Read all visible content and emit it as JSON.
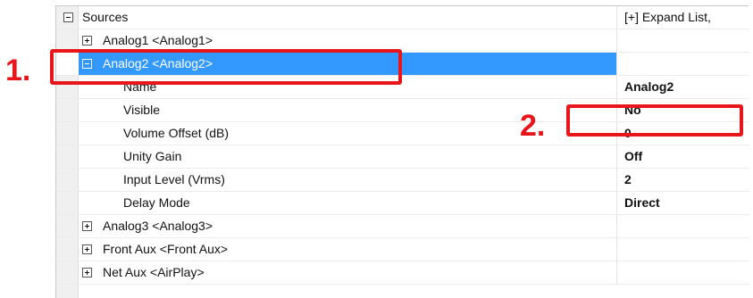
{
  "header": {
    "sources_label": "Sources",
    "expand_list_label": "[+] Expand List,"
  },
  "tree": [
    {
      "label": "Analog1 <Analog1>",
      "state": "collapsed"
    },
    {
      "label": "Analog2 <Analog2>",
      "state": "expanded",
      "selected": true,
      "properties": [
        {
          "name": "Name",
          "value": "Analog2"
        },
        {
          "name": "Visible",
          "value": "No"
        },
        {
          "name": "Volume Offset (dB)",
          "value": "0"
        },
        {
          "name": "Unity Gain",
          "value": "Off"
        },
        {
          "name": "Input Level (Vrms)",
          "value": "2"
        },
        {
          "name": "Delay Mode",
          "value": "Direct"
        }
      ]
    },
    {
      "label": "Analog3 <Analog3>",
      "state": "collapsed"
    },
    {
      "label": "Front Aux <Front Aux>",
      "state": "collapsed"
    },
    {
      "label": "Net Aux <AirPlay>",
      "state": "collapsed"
    }
  ],
  "annotations": {
    "callout_1": "1.",
    "callout_2": "2.",
    "color": "#e8161b"
  },
  "colors": {
    "selection": "#3399ff",
    "gutter": "#f0f0f0"
  }
}
